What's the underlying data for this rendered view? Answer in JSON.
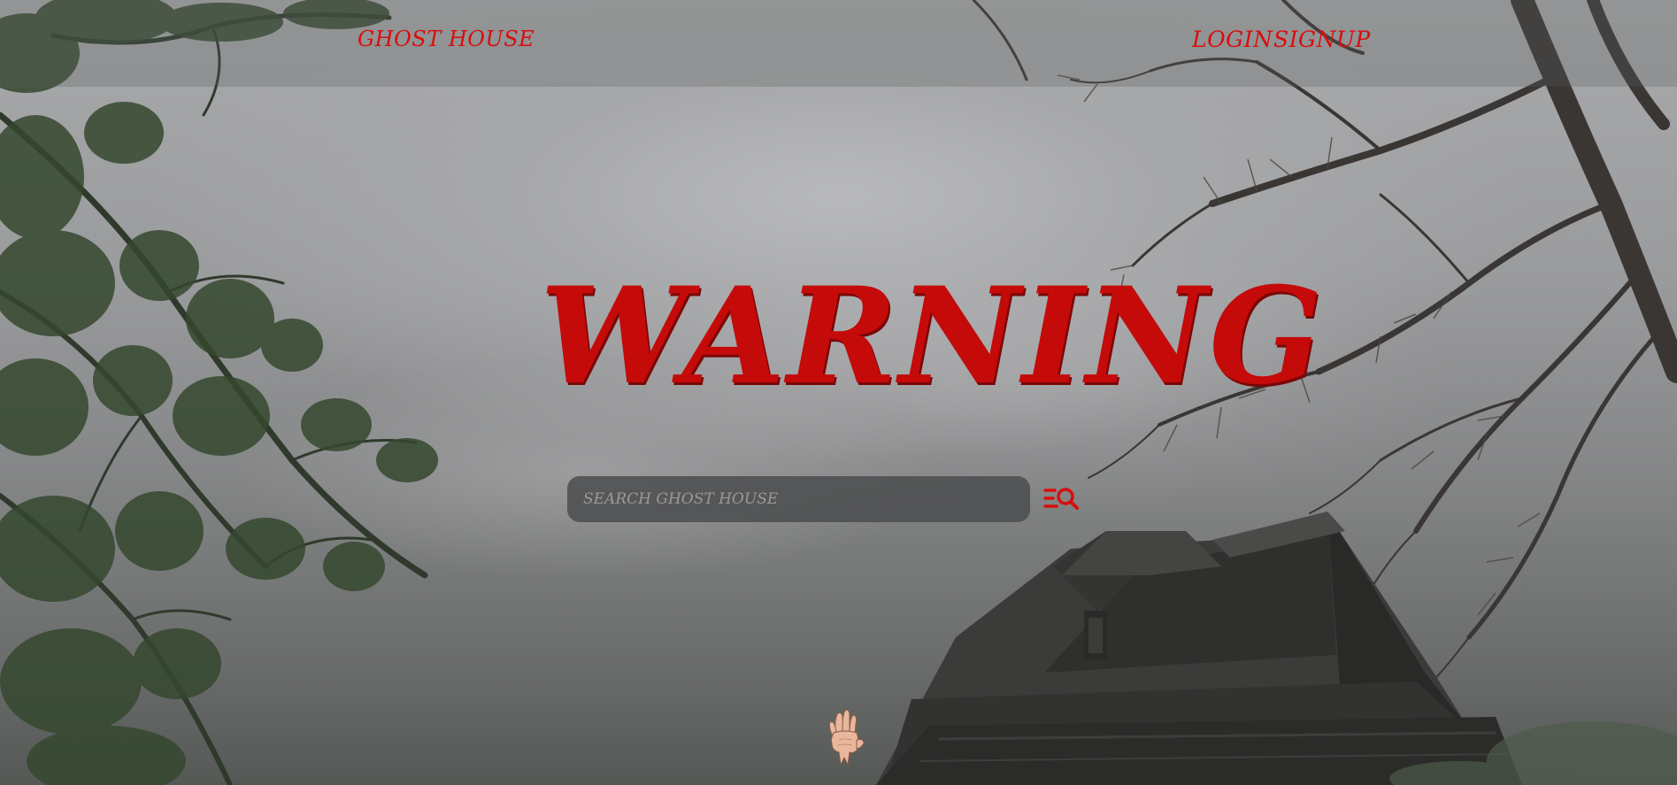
{
  "header": {
    "brand": "GHOST HOUSE",
    "nav": {
      "login": "LOGIN",
      "signup": "SIGNUP"
    }
  },
  "hero": {
    "headline": "WARNING"
  },
  "search": {
    "placeholder": "SEARCH GHOST HOUSE",
    "value": "",
    "button_icon": "list-search-icon"
  },
  "decor": {
    "hand_icon": "creepy-hand-icon"
  },
  "colors": {
    "accent_red": "#d90d0d",
    "headline_red": "#c50a0a",
    "fog_gray": "#a7a8aa",
    "search_bg": "#4b4c4e"
  }
}
